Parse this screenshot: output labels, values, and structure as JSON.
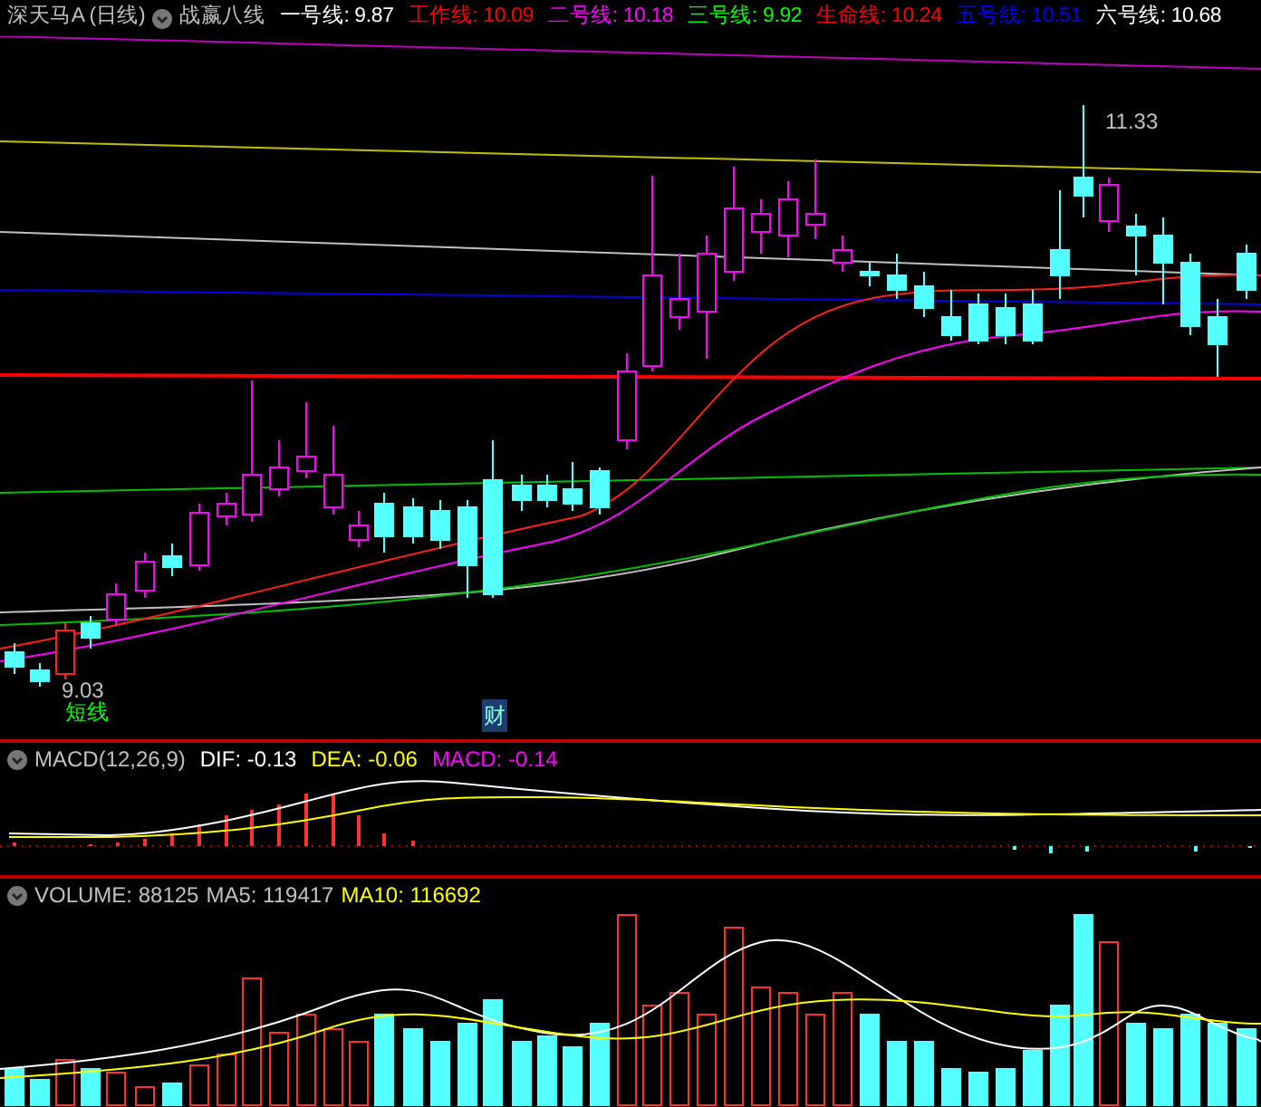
{
  "title": {
    "stock": "深天马A (日线)",
    "indicator": "战嬴八线"
  },
  "legend": [
    {
      "label": "一号线:",
      "value": "9.87",
      "color": "#ffffff"
    },
    {
      "label": "工作线:",
      "value": "10.09",
      "color": "#ff0000"
    },
    {
      "label": "二号线:",
      "value": "10.18",
      "color": "#ff00ff"
    },
    {
      "label": "三号线:",
      "value": "9.92",
      "color": "#00ff00"
    },
    {
      "label": "生命线:",
      "value": "10.24",
      "color": "#ff0000"
    },
    {
      "label": "五号线:",
      "value": "10.51",
      "color": "#0000ff"
    },
    {
      "label": "六号线:",
      "value": "10.68",
      "color": "#ffffff"
    }
  ],
  "main_chart": {
    "high_marker": "11.33",
    "low_marker": "9.03",
    "signal_label": "短线",
    "event_tag": "财"
  },
  "macd": {
    "name": "MACD(12,26,9)",
    "items": [
      {
        "label": "DIF:",
        "value": "-0.13",
        "color": "#ffffff"
      },
      {
        "label": "DEA:",
        "value": "-0.06",
        "color": "#ffff00"
      },
      {
        "label": "MACD:",
        "value": "-0.14",
        "color": "#ff00ff"
      }
    ]
  },
  "volume": {
    "items": [
      {
        "label": "VOLUME:",
        "value": "88125",
        "color": "#c0c0c0"
      },
      {
        "label": "MA5:",
        "value": "119417",
        "color": "#c0c0c0"
      },
      {
        "label": "MA10:",
        "value": "116692",
        "color": "#ffff00"
      }
    ]
  }
}
